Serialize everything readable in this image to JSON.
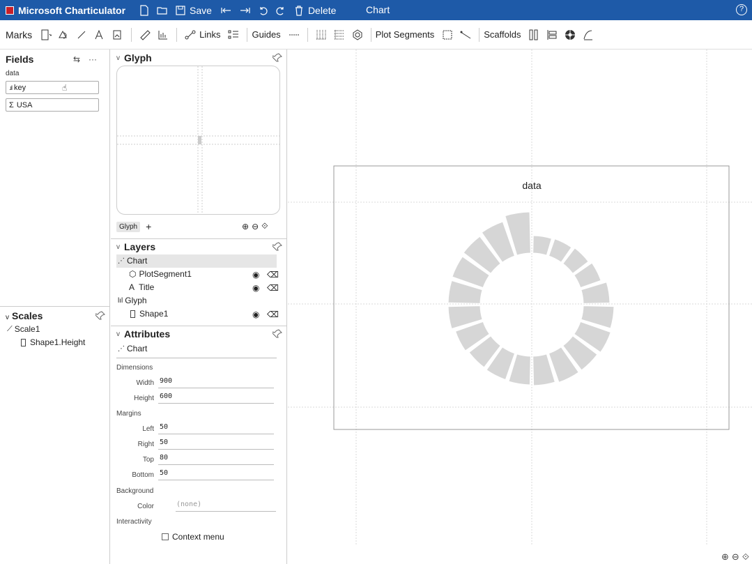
{
  "titlebar": {
    "app_name": "Microsoft Charticulator",
    "save_label": "Save",
    "delete_label": "Delete",
    "doc_title": "Chart",
    "help_label": "?"
  },
  "toolbar": {
    "marks_label": "Marks",
    "links_label": "Links",
    "guides_label": "Guides",
    "plot_segments_label": "Plot Segments",
    "scaffolds_label": "Scaffolds"
  },
  "fields": {
    "title": "Fields",
    "table_name": "data",
    "items": [
      {
        "label": "key",
        "icon": "categorical-icon"
      },
      {
        "label": "USA",
        "icon": "sum-icon"
      }
    ]
  },
  "scales": {
    "title": "Scales",
    "items": [
      {
        "label": "Scale1"
      },
      {
        "label": "Shape1.Height"
      }
    ]
  },
  "glyph": {
    "title": "Glyph",
    "tab_label": "Glyph",
    "add_label": "+"
  },
  "layers": {
    "title": "Layers",
    "items": [
      {
        "label": "Chart",
        "level": 0
      },
      {
        "label": "PlotSegment1",
        "level": 1
      },
      {
        "label": "Title",
        "level": 1
      },
      {
        "label": "Glyph",
        "level": 0
      },
      {
        "label": "Shape1",
        "level": 1
      }
    ]
  },
  "attributes": {
    "title": "Attributes",
    "object_label": "Chart",
    "dimensions_label": "Dimensions",
    "width_label": "Width",
    "width_value": "900",
    "height_label": "Height",
    "height_value": "600",
    "margins_label": "Margins",
    "left_label": "Left",
    "left_value": "50",
    "right_label": "Right",
    "right_value": "50",
    "top_label": "Top",
    "top_value": "80",
    "bottom_label": "Bottom",
    "bottom_value": "50",
    "background_label": "Background",
    "color_label": "Color",
    "color_placeholder": "(none)",
    "interactivity_label": "Interactivity",
    "context_menu_label": "Context menu"
  },
  "chart": {
    "title": "data",
    "segment_count": 20,
    "segment_color": "#d6d6d6",
    "rgt_note": ""
  },
  "colors": {
    "titlebar_bg": "#1e5aa8",
    "selected_row_bg": "#e6e6e6"
  }
}
